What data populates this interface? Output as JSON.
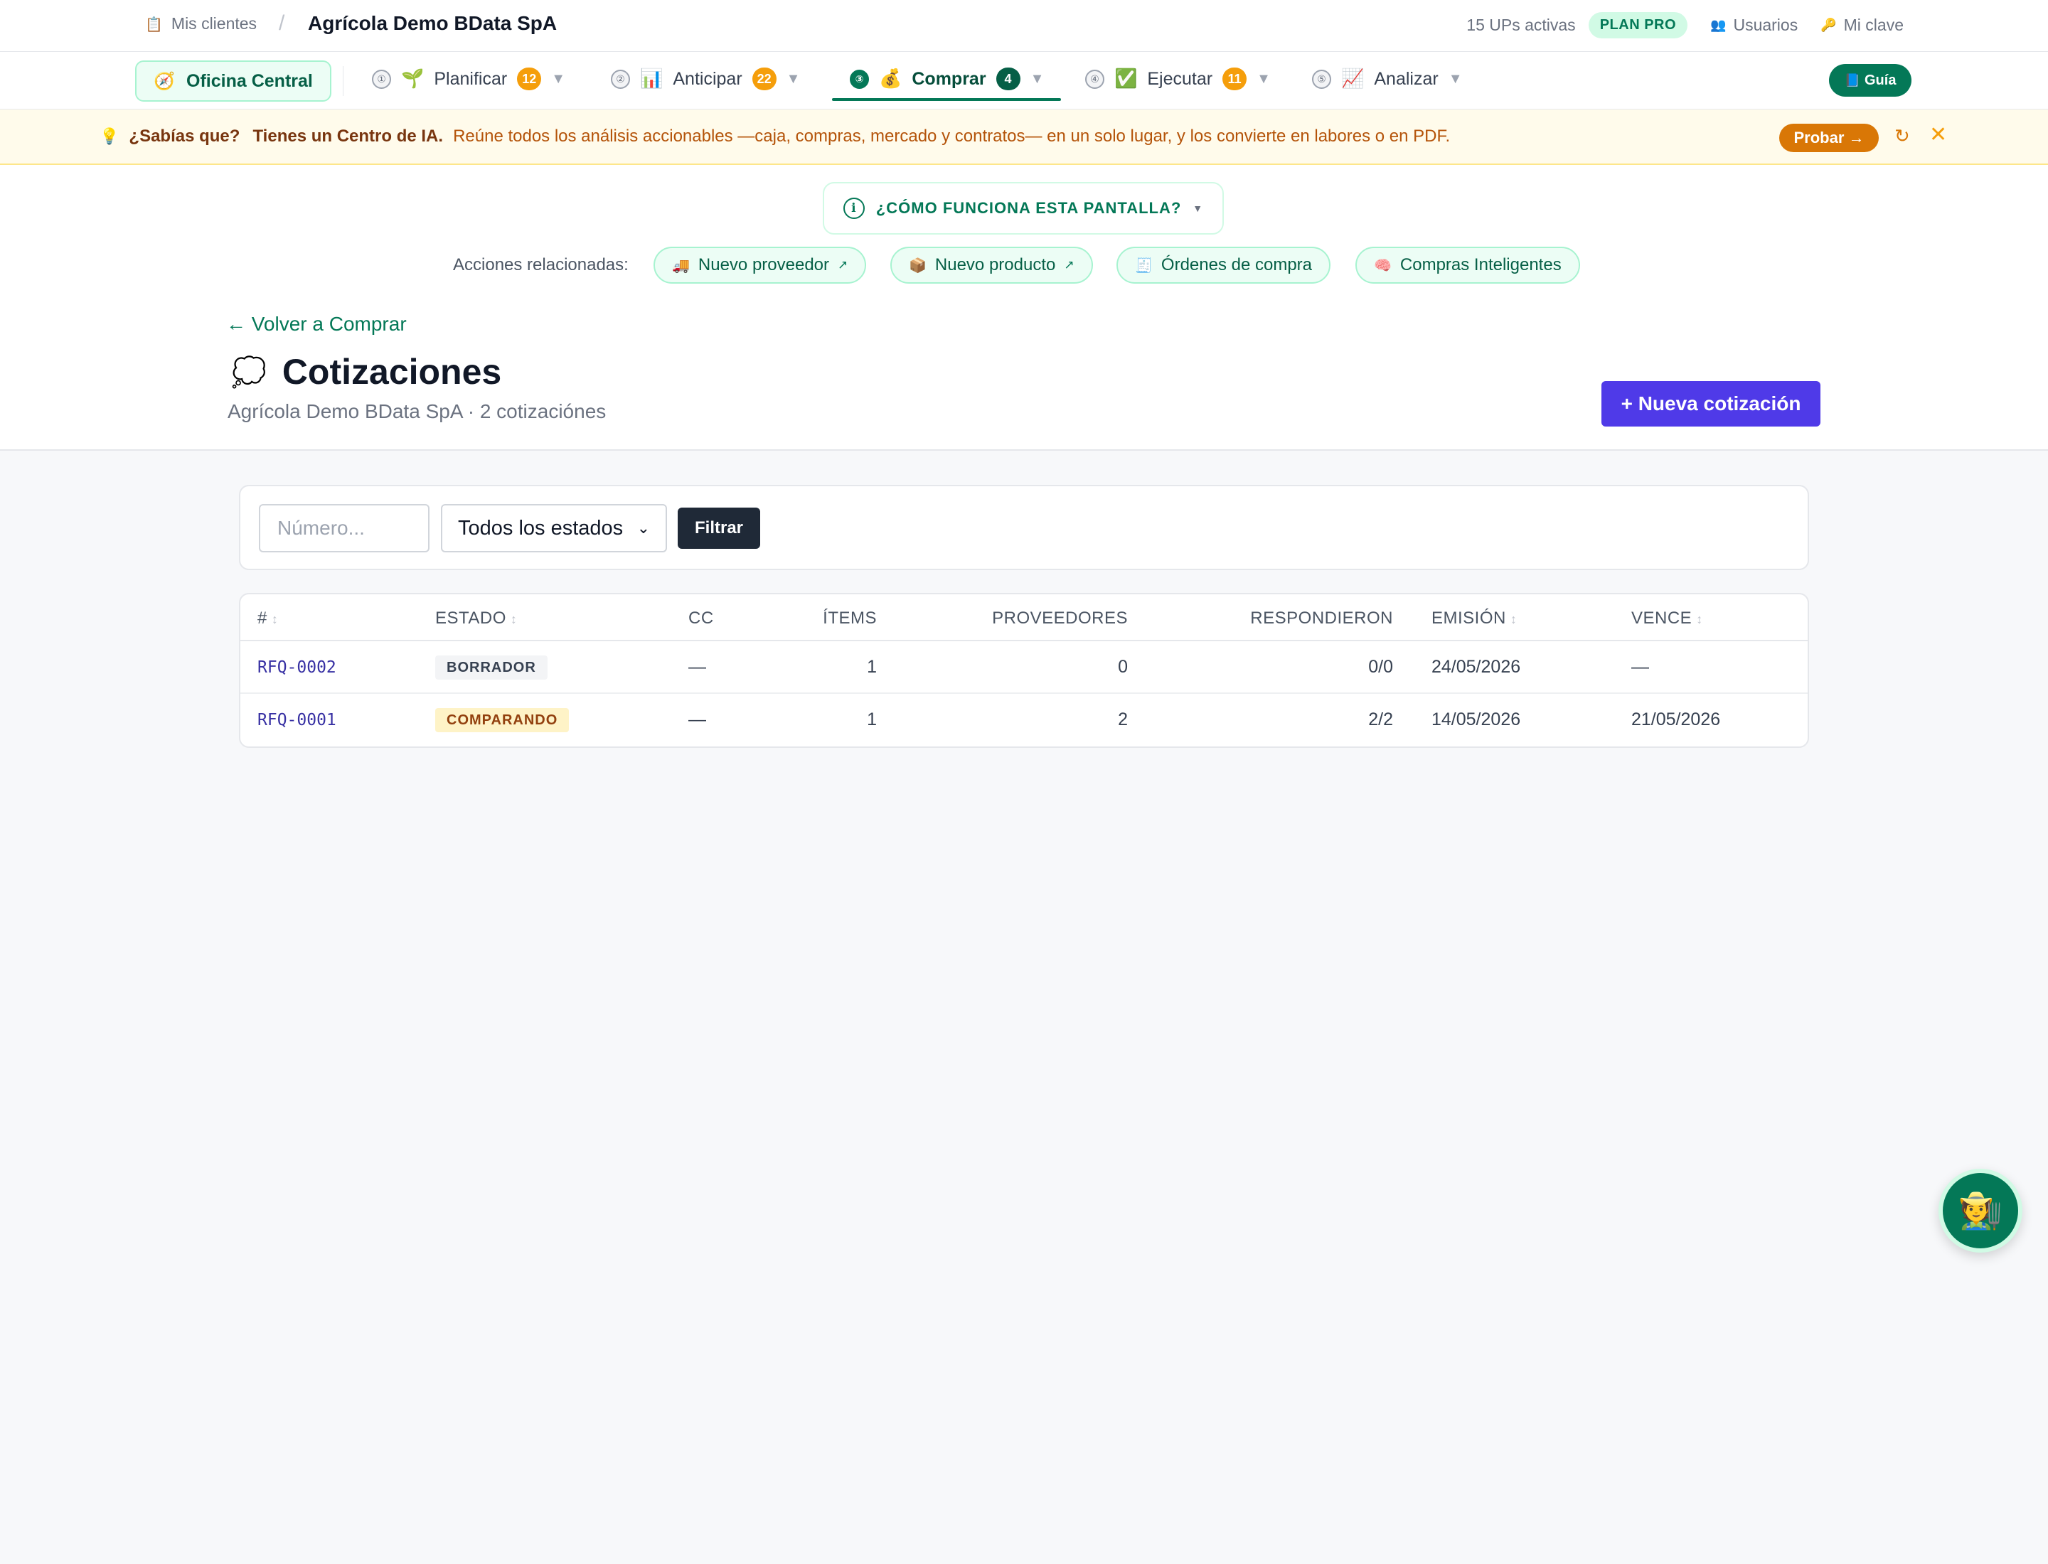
{
  "topbar": {
    "my_clients": "Mis clientes",
    "client_name": "Agrícola Demo BData SpA",
    "active_ups": "15 UPs activas",
    "plan": "PLAN PRO",
    "users": "Usuarios",
    "my_key": "Mi clave"
  },
  "nav": {
    "office": "Oficina Central",
    "items": [
      {
        "step": "①",
        "label": "Planificar",
        "badge": "12"
      },
      {
        "step": "②",
        "label": "Anticipar",
        "badge": "22"
      },
      {
        "step": "③",
        "label": "Comprar",
        "badge": "4"
      },
      {
        "step": "④",
        "label": "Ejecutar",
        "badge": "11"
      },
      {
        "step": "⑤",
        "label": "Analizar"
      }
    ],
    "guide": "Guía"
  },
  "tip": {
    "question": "¿Sabías que?",
    "headline": "Tienes un Centro de IA.",
    "body": "Reúne todos los análisis accionables —caja, compras, mercado y contratos— en un solo lugar, y los convierte en labores o en PDF.",
    "try_label": "Probar →"
  },
  "help": {
    "how_label": "¿CÓMO FUNCIONA ESTA PANTALLA?"
  },
  "related": {
    "label": "Acciones relacionadas:",
    "chips": [
      {
        "label": "Nuevo proveedor"
      },
      {
        "label": "Nuevo producto"
      },
      {
        "label": "Órdenes de compra"
      },
      {
        "label": "Compras Inteligentes"
      }
    ]
  },
  "page": {
    "back": "← Volver a Comprar",
    "title": "Cotizaciones",
    "subtitle": "Agrícola Demo BData SpA · 2 cotizaciónes",
    "new_button": "+ Nueva cotización"
  },
  "filters": {
    "number_placeholder": "Número...",
    "status_selected": "Todos los estados",
    "filter_button": "Filtrar"
  },
  "table": {
    "headers": {
      "num": "#",
      "status": "ESTADO",
      "cc": "CC",
      "items": "ÍTEMS",
      "providers": "PROVEEDORES",
      "responded": "RESPONDIERON",
      "issued": "EMISIÓN",
      "due": "VENCE"
    },
    "rows": [
      {
        "num": "RFQ-0002",
        "status": "BORRADOR",
        "cc": "—",
        "items": "1",
        "providers": "0",
        "responded": "0/0",
        "issued": "24/05/2026",
        "due": "—"
      },
      {
        "num": "RFQ-0001",
        "status": "COMPARANDO",
        "cc": "—",
        "items": "1",
        "providers": "2",
        "responded": "2/2",
        "issued": "14/05/2026",
        "due": "21/05/2026"
      }
    ]
  }
}
